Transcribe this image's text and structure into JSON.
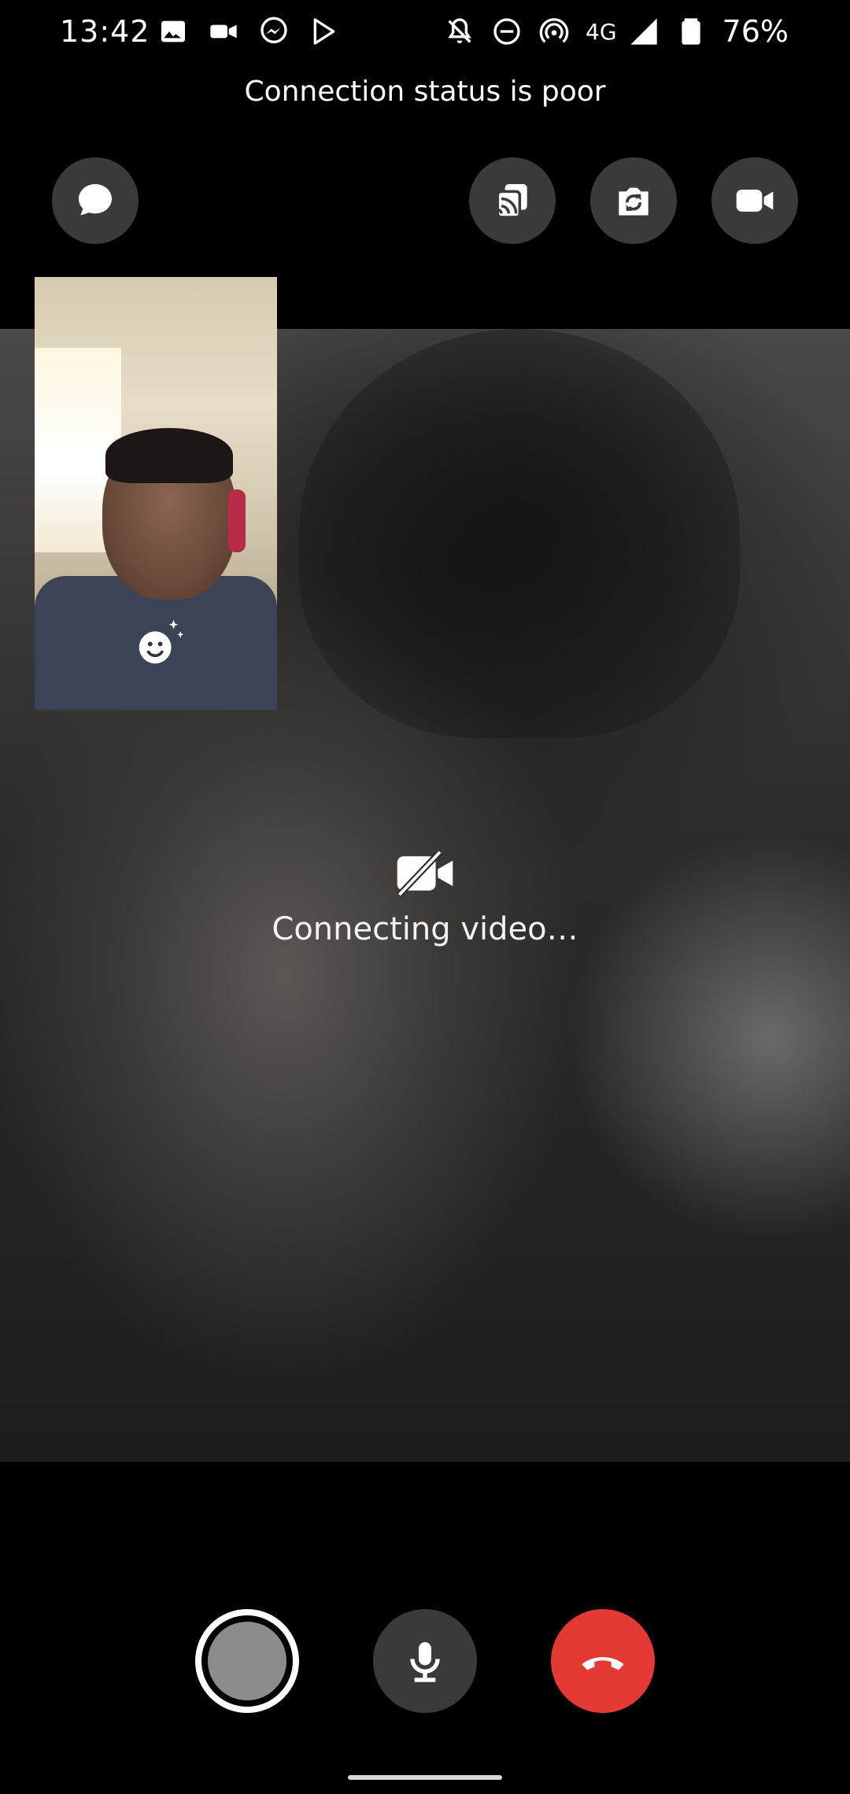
{
  "status_bar": {
    "time": "13:42",
    "network": "4G",
    "battery": "76%",
    "left_icons": [
      "image-icon",
      "video-camera-icon",
      "messenger-icon",
      "play-store-icon"
    ],
    "right_icons": [
      "notifications-off-icon",
      "do-not-disturb-icon",
      "hotspot-icon",
      "signal-icon",
      "battery-icon"
    ]
  },
  "call": {
    "connection_status": "Connection status is poor",
    "video_status": "Connecting video…"
  },
  "top_controls": {
    "chat_icon": "chat-bubble-icon",
    "cast_icon": "cast-icon",
    "flip_camera_icon": "flip-camera-icon",
    "video_icon": "video-camera-icon"
  },
  "self_preview": {
    "effects_icon": "effects-smiley-icon"
  },
  "bottom_controls": {
    "capture_icon": "capture-icon",
    "mic_icon": "microphone-icon",
    "end_call_icon": "end-call-icon"
  },
  "colors": {
    "background": "#000000",
    "button_bg": "#3a3a3a",
    "end_call": "#e53935",
    "text": "#ffffff"
  }
}
